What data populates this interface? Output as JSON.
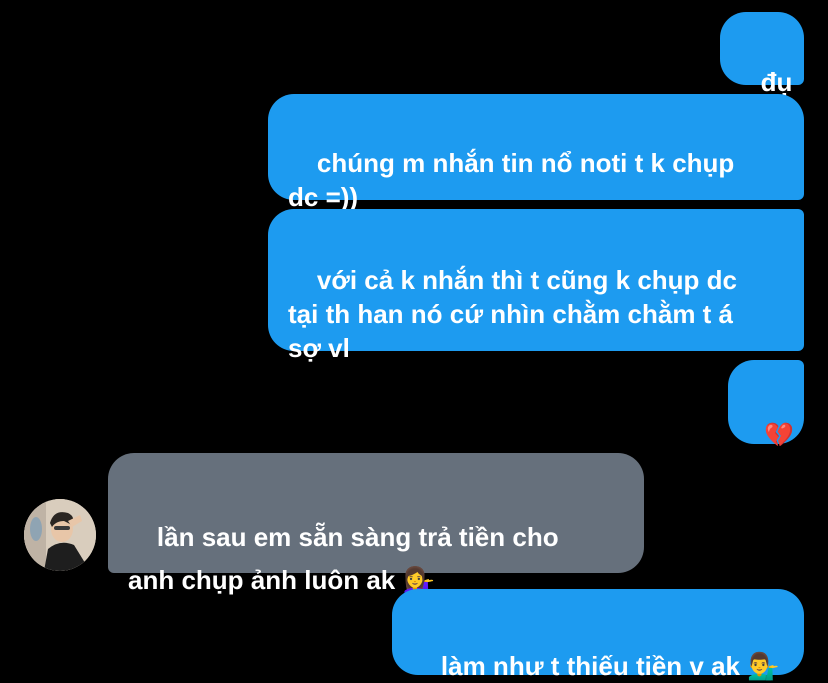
{
  "conversation": {
    "messages": [
      {
        "id": "m1",
        "direction": "sent",
        "text": "đụ"
      },
      {
        "id": "m2",
        "direction": "sent",
        "text": "chúng m nhắn tin nổ noti t k chụp\ndc =))"
      },
      {
        "id": "m3",
        "direction": "sent",
        "text": "với cả k nhắn thì t cũng k chụp dc\ntại th han nó cứ nhìn chằm chằm t á\nsợ vl"
      },
      {
        "id": "m4",
        "direction": "sent",
        "text": "💔"
      },
      {
        "id": "m5",
        "direction": "received",
        "text": "lần sau em sẵn sàng trả tiền cho\nanh chụp ảnh luôn ak 💁‍♀️"
      },
      {
        "id": "m6",
        "direction": "sent",
        "text": "làm như t thiếu tiền v ak 💁‍♂️"
      }
    ]
  },
  "colors": {
    "background": "#000000",
    "sent_bubble": "#1d9bf0",
    "received_bubble": "#66707c",
    "text": "#ffffff"
  },
  "icons": {
    "avatar": "contact-avatar"
  }
}
